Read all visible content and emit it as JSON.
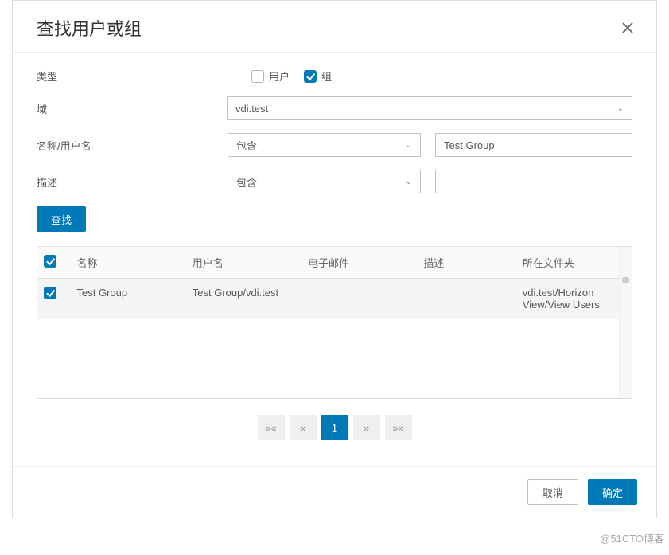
{
  "dialog": {
    "title": "查找用户或组"
  },
  "form": {
    "type_label": "类型",
    "user_cb_label": "用户",
    "group_cb_label": "组",
    "domain_label": "域",
    "domain_value": "vdi.test",
    "name_label": "名称/用户名",
    "name_op": "包含",
    "name_value": "Test Group",
    "desc_label": "描述",
    "desc_op": "包含",
    "desc_value": ""
  },
  "buttons": {
    "search": "查找",
    "cancel": "取消",
    "ok": "确定"
  },
  "table": {
    "headers": {
      "name": "名称",
      "user": "用户名",
      "email": "电子邮件",
      "desc": "描述",
      "folder": "所在文件夹"
    },
    "rows": [
      {
        "name": "Test Group",
        "user": "Test Group/vdi.test",
        "email": "",
        "desc": "",
        "folder": "vdi.test/Horizon View/View Users"
      }
    ]
  },
  "pagination": {
    "first": "««",
    "prev": "«",
    "page1": "1",
    "next": "»",
    "last": "»»"
  },
  "watermark": "@51CTO博客"
}
